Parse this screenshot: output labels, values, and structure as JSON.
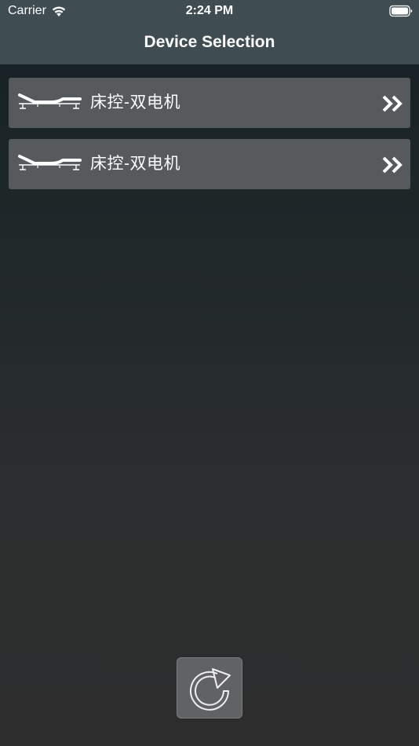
{
  "status_bar": {
    "carrier": "Carrier",
    "time": "2:24 PM",
    "wifi_icon": "wifi-icon",
    "battery_icon": "battery-icon"
  },
  "nav": {
    "title": "Device Selection"
  },
  "devices": [
    {
      "label": "床控-双电机",
      "icon": "adjustable-bed-icon",
      "action_icon": "double-chevron-right-icon"
    },
    {
      "label": "床控-双电机",
      "icon": "adjustable-bed-icon",
      "action_icon": "double-chevron-right-icon"
    }
  ],
  "refresh": {
    "icon": "refresh-icon"
  },
  "colors": {
    "nav_background": "#3f4c52",
    "row_background": "#575a5d",
    "page_background_top": "#152024",
    "page_background_bottom": "#2d2d2d",
    "text": "#ffffff"
  }
}
